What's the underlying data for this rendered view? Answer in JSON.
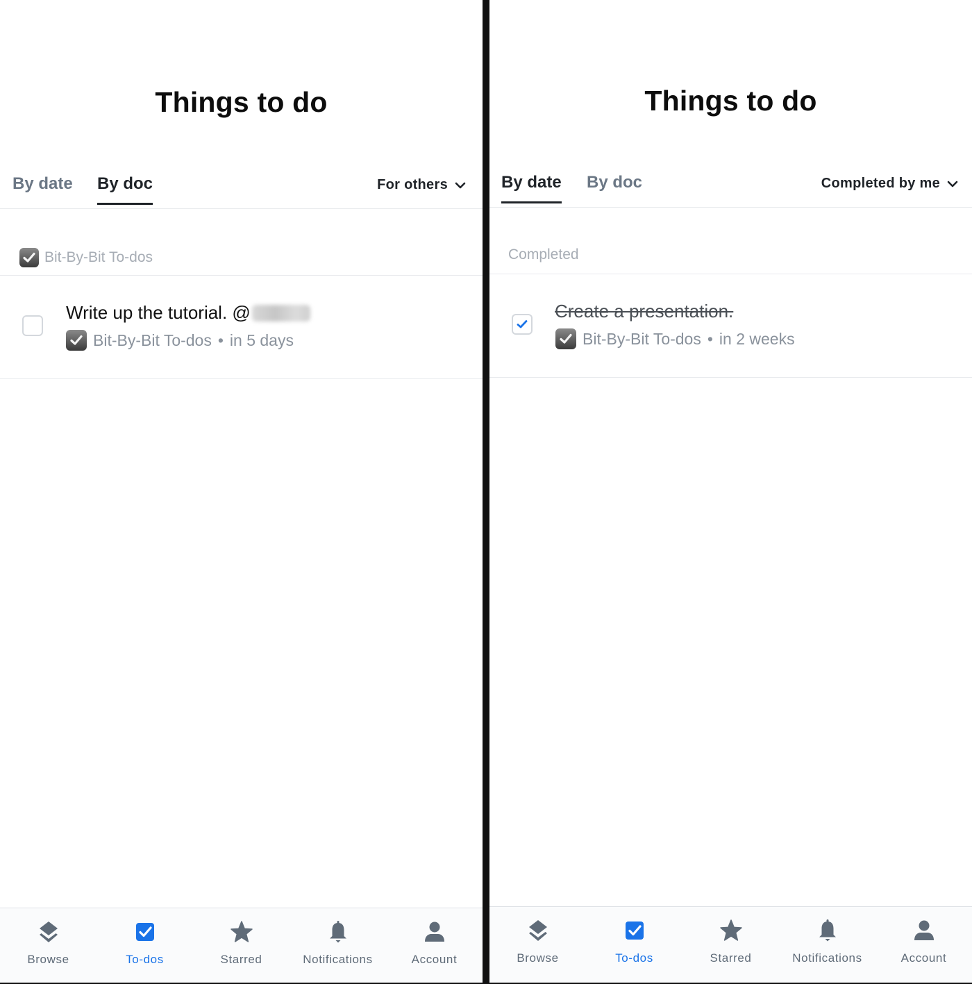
{
  "screens": [
    {
      "title": "Things to do",
      "tabs": [
        {
          "label": "By date",
          "active": false
        },
        {
          "label": "By doc",
          "active": true
        }
      ],
      "filter": {
        "label": "For others",
        "icon": "chevron-down-icon"
      },
      "section": {
        "label": "Bit-By-Bit To-dos",
        "icon": "doc-checkbox-icon"
      },
      "task": {
        "text": "Write up the tutorial. @",
        "mention_redacted": true,
        "completed": false,
        "doc": "Bit-By-Bit To-dos",
        "separator": "•",
        "due": "in 5 days"
      }
    },
    {
      "title": "Things to do",
      "tabs": [
        {
          "label": "By date",
          "active": true
        },
        {
          "label": "By doc",
          "active": false
        }
      ],
      "filter": {
        "label": "Completed by me",
        "icon": "chevron-down-icon"
      },
      "section": {
        "label": "Completed"
      },
      "task": {
        "text": "Create a presentation.",
        "completed": true,
        "doc": "Bit-By-Bit To-dos",
        "separator": "•",
        "due": "in 2 weeks"
      }
    }
  ],
  "bottom_nav": [
    {
      "label": "Browse",
      "icon": "layers-icon",
      "active": false
    },
    {
      "label": "To-dos",
      "icon": "todo-checkbox-icon",
      "active": true
    },
    {
      "label": "Starred",
      "icon": "star-icon",
      "active": false
    },
    {
      "label": "Notifications",
      "icon": "bell-icon",
      "active": false
    },
    {
      "label": "Account",
      "icon": "person-icon",
      "active": false
    }
  ],
  "colors": {
    "accent": "#1a73e8",
    "nav_icon": "#5f6b78",
    "muted_text": "#8a929c",
    "divider": "#111111"
  }
}
